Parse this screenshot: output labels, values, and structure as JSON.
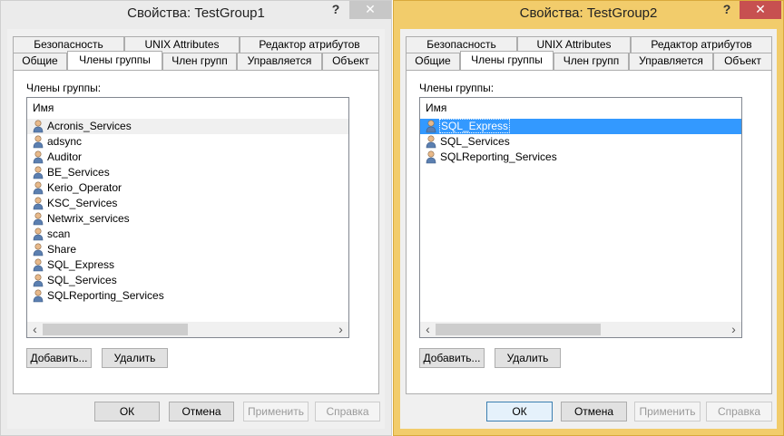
{
  "windows": [
    {
      "title": "Свойства: TestGroup1",
      "help": "?",
      "close": "✕",
      "tabs_row1": [
        "Безопасность",
        "UNIX Attributes",
        "Редактор атрибутов"
      ],
      "tabs_row2": [
        "Общие",
        "Члены группы",
        "Член групп",
        "Управляется",
        "Объект"
      ],
      "active_tab": "Члены группы",
      "members_label": "Члены группы:",
      "column_header": "Имя",
      "members": [
        "Acronis_Services",
        "adsync",
        "Auditor",
        "BE_Services",
        "Kerio_Operator",
        "KSC_Services",
        "Netwrix_services",
        "scan",
        "Share",
        "SQL_Express",
        "SQL_Services",
        "SQLReporting_Services"
      ],
      "add_button": "Добавить...",
      "remove_button": "Удалить",
      "ok_button": "ОК",
      "cancel_button": "Отмена",
      "apply_button": "Применить",
      "help_button": "Справка"
    },
    {
      "title": "Свойства: TestGroup2",
      "help": "?",
      "close": "✕",
      "tabs_row1": [
        "Безопасность",
        "UNIX Attributes",
        "Редактор атрибутов"
      ],
      "tabs_row2": [
        "Общие",
        "Члены группы",
        "Член групп",
        "Управляется",
        "Объект"
      ],
      "active_tab": "Члены группы",
      "members_label": "Члены группы:",
      "column_header": "Имя",
      "members": [
        "SQL_Express",
        "SQL_Services",
        "SQLReporting_Services"
      ],
      "selected_member": "SQL_Express",
      "add_button": "Добавить...",
      "remove_button": "Удалить",
      "ok_button": "ОК",
      "cancel_button": "Отмена",
      "apply_button": "Применить",
      "help_button": "Справка"
    }
  ],
  "colors": {
    "active_window_frame": "#f2cc6b",
    "inactive_window_frame": "#ebebeb",
    "selection": "#3399ff",
    "close_active": "#c75050"
  },
  "icons": {
    "list_item": "user-icon"
  }
}
